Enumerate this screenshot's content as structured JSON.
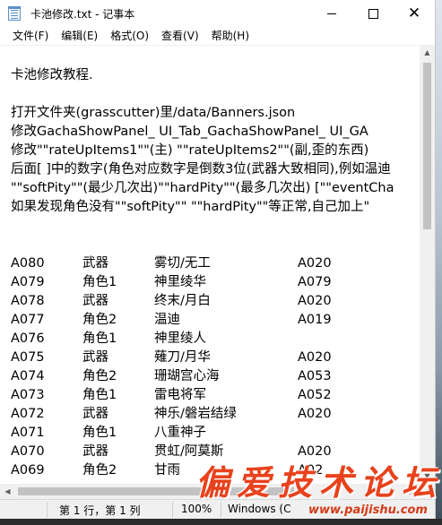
{
  "window": {
    "title": "卡池修改.txt - 记事本"
  },
  "menu": [
    "文件(F)",
    "编辑(E)",
    "格式(O)",
    "查看(V)",
    "帮助(H)"
  ],
  "text_lines": [
    "卡池修改教程.",
    "",
    "打开文件夹(grasscutter)里/data/Banners.json",
    "修改GachaShowPanel_   UI_Tab_GachaShowPanel_    UI_GA",
    "修改\"\"rateUpItems1\"\"(主)    \"\"rateUpItems2\"\"(副,歪的东西)",
    "后面[  ]中的数字(角色对应数字是倒数3位(武器大致相同),例如温迪",
    "\"\"softPity\"\"(最少几次出)\"\"hardPity\"\"(最多几次出)   [\"\"eventCha",
    "如果发现角色没有\"\"softPity\"\" \"\"hardPity\"\"等正常,自己加上\""
  ],
  "table_rows": [
    [
      "A080",
      "武器",
      "雾切/无工",
      "A020"
    ],
    [
      "A079",
      "角色1",
      "神里绫华",
      "A079"
    ],
    [
      "A078",
      "武器",
      "终末/月白",
      "A020"
    ],
    [
      "A077",
      "角色2",
      "温迪",
      "A019"
    ],
    [
      "A076",
      "角色1",
      "神里绫人",
      ""
    ],
    [
      "A075",
      "武器",
      "薙刀/月华",
      "A020"
    ],
    [
      "A074",
      "角色2",
      "珊瑚宫心海",
      "A053"
    ],
    [
      "A073",
      "角色1",
      "雷电将军",
      "A052"
    ],
    [
      "A072",
      "武器",
      "神乐/磐岩结绿",
      "A020"
    ],
    [
      "A071",
      "角色1",
      "八重神子",
      ""
    ],
    [
      "A070",
      "武器",
      "贯虹/阿莫斯",
      "A020"
    ],
    [
      "A069",
      "角色2",
      "甘雨",
      "A02"
    ]
  ],
  "status": {
    "position": "第 1 行，第 1 列",
    "zoom": "100%",
    "line_ending": "Windows (C"
  },
  "watermark": {
    "big": "偏爱技术论坛",
    "url": "www.paijishu.com"
  }
}
